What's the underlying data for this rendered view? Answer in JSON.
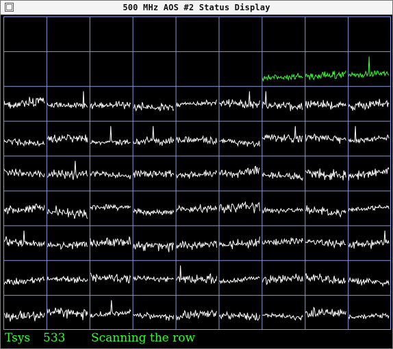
{
  "window": {
    "title": "500 MHz AOS #2 Status Display",
    "close_icon": "window-close-box-icon"
  },
  "display": {
    "rows": 9,
    "cols": 9,
    "grid_color": "#8899dd",
    "spectrum_color": "#ffffff",
    "active_spectrum_color": "#33ff33",
    "background": "#000000"
  },
  "status": {
    "label": "Tsys",
    "value": "533",
    "message": "Scanning the row",
    "color": "#31ff31"
  }
}
